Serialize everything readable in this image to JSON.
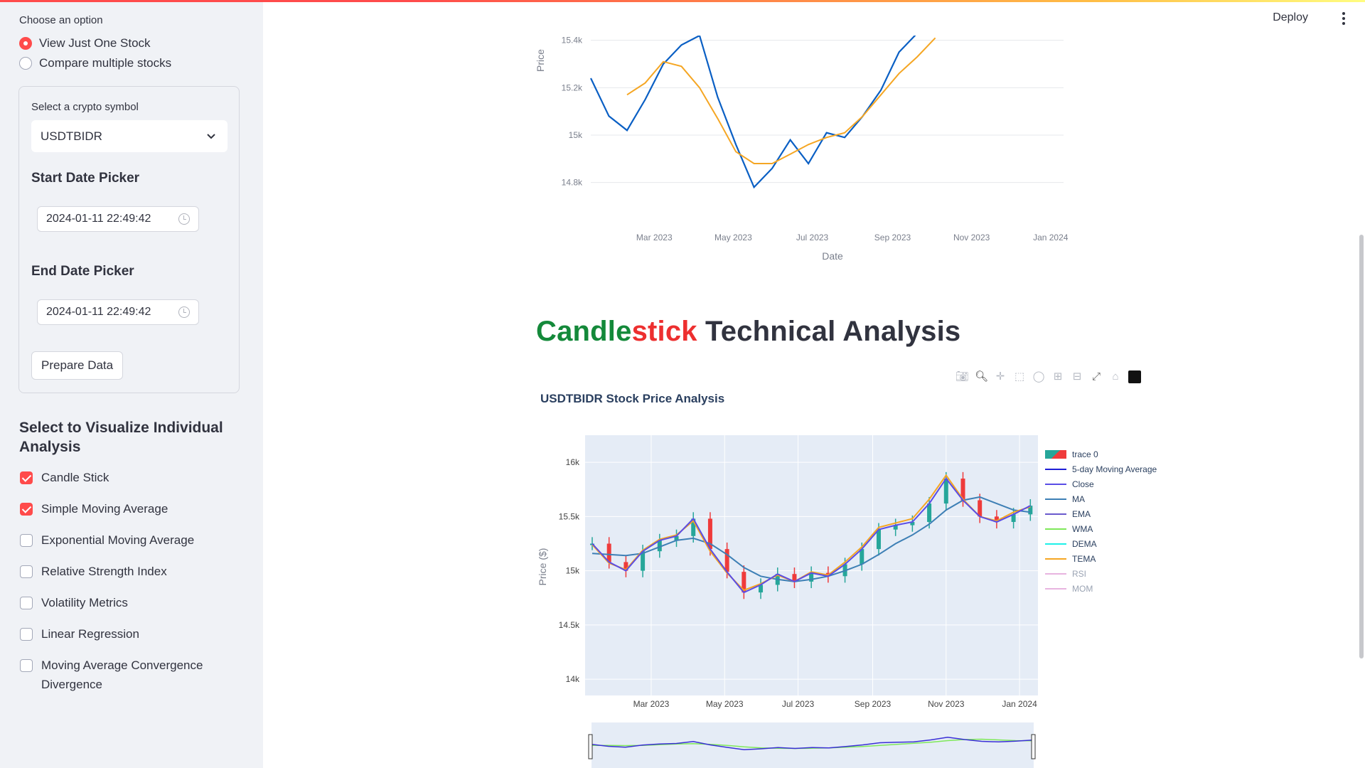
{
  "header": {
    "deploy_label": "Deploy"
  },
  "sidebar": {
    "choose_label": "Choose an option",
    "options": [
      {
        "label": "View Just One Stock",
        "selected": true
      },
      {
        "label": "Compare multiple stocks",
        "selected": false
      }
    ],
    "symbol_label": "Select a crypto symbol",
    "symbol_value": "USDTBIDR",
    "start_title": "Start Date Picker",
    "start_value": "2024-01-11 22:49:42",
    "end_title": "End Date Picker",
    "end_value": "2024-01-11 22:49:42",
    "prepare_button": "Prepare Data",
    "visualize_title": "Select to Visualize Individual Analysis",
    "checkboxes": [
      {
        "label": "Candle Stick",
        "checked": true
      },
      {
        "label": "Simple Moving Average",
        "checked": true
      },
      {
        "label": "Exponential Moving Average",
        "checked": false
      },
      {
        "label": "Relative Strength Index",
        "checked": false
      },
      {
        "label": "Volatility Metrics",
        "checked": false
      },
      {
        "label": "Linear Regression",
        "checked": false
      },
      {
        "label": "Moving Average Convergence Divergence",
        "checked": false
      }
    ]
  },
  "section": {
    "title_part1": "Candle",
    "title_part2": "stick",
    "title_part3": " Technical Analysis"
  },
  "chart_data": [
    {
      "type": "line",
      "title": "",
      "xlabel": "Date",
      "ylabel": "Price",
      "x_ticks": [
        "Mar 2023",
        "May 2023",
        "Jul 2023",
        "Sep 2023",
        "Nov 2023",
        "Jan 2024"
      ],
      "y_ticks": [
        "14.8k",
        "15k",
        "15.2k",
        "15.4k"
      ],
      "ylim": [
        14700,
        15450
      ],
      "series": [
        {
          "color": "#0a5fc4",
          "x": [
            "2023-01-11",
            "2023-01-25",
            "2023-02-08",
            "2023-02-22",
            "2023-03-08",
            "2023-03-22",
            "2023-04-05",
            "2023-04-19",
            "2023-05-03",
            "2023-05-17",
            "2023-05-31",
            "2023-06-14",
            "2023-06-28",
            "2023-07-12",
            "2023-07-26",
            "2023-08-09",
            "2023-08-23",
            "2023-09-06",
            "2023-09-20",
            "2023-10-04"
          ],
          "values": [
            15240,
            15080,
            15020,
            15150,
            15300,
            15380,
            15420,
            15160,
            14960,
            14780,
            14860,
            14980,
            14880,
            15010,
            14990,
            15080,
            15190,
            15350,
            15430,
            15450
          ]
        },
        {
          "color": "#f5a623",
          "x": [
            "2023-02-08",
            "2023-02-22",
            "2023-03-08",
            "2023-03-22",
            "2023-04-05",
            "2023-04-19",
            "2023-05-03",
            "2023-05-17",
            "2023-05-31",
            "2023-06-14",
            "2023-06-28",
            "2023-07-12",
            "2023-07-26",
            "2023-08-09",
            "2023-08-23",
            "2023-09-06",
            "2023-09-20",
            "2023-10-04"
          ],
          "values": [
            15170,
            15220,
            15310,
            15290,
            15200,
            15070,
            14930,
            14880,
            14880,
            14920,
            14960,
            14990,
            15010,
            15080,
            15170,
            15260,
            15330,
            15410
          ]
        }
      ]
    },
    {
      "type": "line",
      "title": "USDTBIDR Stock Price Analysis",
      "xlabel": "",
      "ylabel": "Price ($)",
      "x_ticks": [
        "Mar 2023",
        "May 2023",
        "Jul 2023",
        "Sep 2023",
        "Nov 2023",
        "Jan 2024"
      ],
      "y_ticks": [
        "14k",
        "14.5k",
        "15k",
        "15.5k",
        "16k"
      ],
      "ylim": [
        13850,
        16250
      ],
      "legend": [
        "trace 0",
        "5-day Moving Average",
        "Close",
        "MA",
        "EMA",
        "WMA",
        "DEMA",
        "TEMA",
        "RSI",
        "MOM"
      ],
      "legend_colors": [
        "#26a69a",
        "#1f1fd6",
        "#5a4de6",
        "#3d7fb5",
        "#6a5acd",
        "#7fe85a",
        "#1ef0e8",
        "#f5a623",
        "#e8b4e0",
        "#e8b4e0"
      ],
      "x": [
        "2023-01-11",
        "2023-01-25",
        "2023-02-08",
        "2023-02-22",
        "2023-03-08",
        "2023-03-22",
        "2023-04-05",
        "2023-04-19",
        "2023-05-03",
        "2023-05-17",
        "2023-05-31",
        "2023-06-14",
        "2023-06-28",
        "2023-07-12",
        "2023-07-26",
        "2023-08-09",
        "2023-08-23",
        "2023-09-06",
        "2023-09-20",
        "2023-10-04",
        "2023-10-18",
        "2023-11-01",
        "2023-11-15",
        "2023-11-29",
        "2023-12-13",
        "2023-12-27",
        "2024-01-10"
      ],
      "close": [
        15250,
        15080,
        15000,
        15180,
        15280,
        15320,
        15480,
        15200,
        14990,
        14800,
        14870,
        14970,
        14900,
        14980,
        14950,
        15060,
        15200,
        15380,
        15420,
        15450,
        15620,
        15850,
        15650,
        15500,
        15450,
        15520,
        15600
      ],
      "ma": [
        15160,
        15150,
        15140,
        15160,
        15220,
        15280,
        15300,
        15250,
        15150,
        15030,
        14950,
        14920,
        14900,
        14920,
        14950,
        15000,
        15060,
        15150,
        15250,
        15330,
        15430,
        15560,
        15650,
        15680,
        15620,
        15560,
        15540
      ],
      "tema": [
        15240,
        15070,
        15010,
        15190,
        15290,
        15330,
        15460,
        15180,
        14980,
        14820,
        14880,
        14960,
        14900,
        14990,
        14960,
        15080,
        15220,
        15400,
        15440,
        15480,
        15660,
        15880,
        15660,
        15500,
        15460,
        15540,
        15590
      ]
    }
  ]
}
